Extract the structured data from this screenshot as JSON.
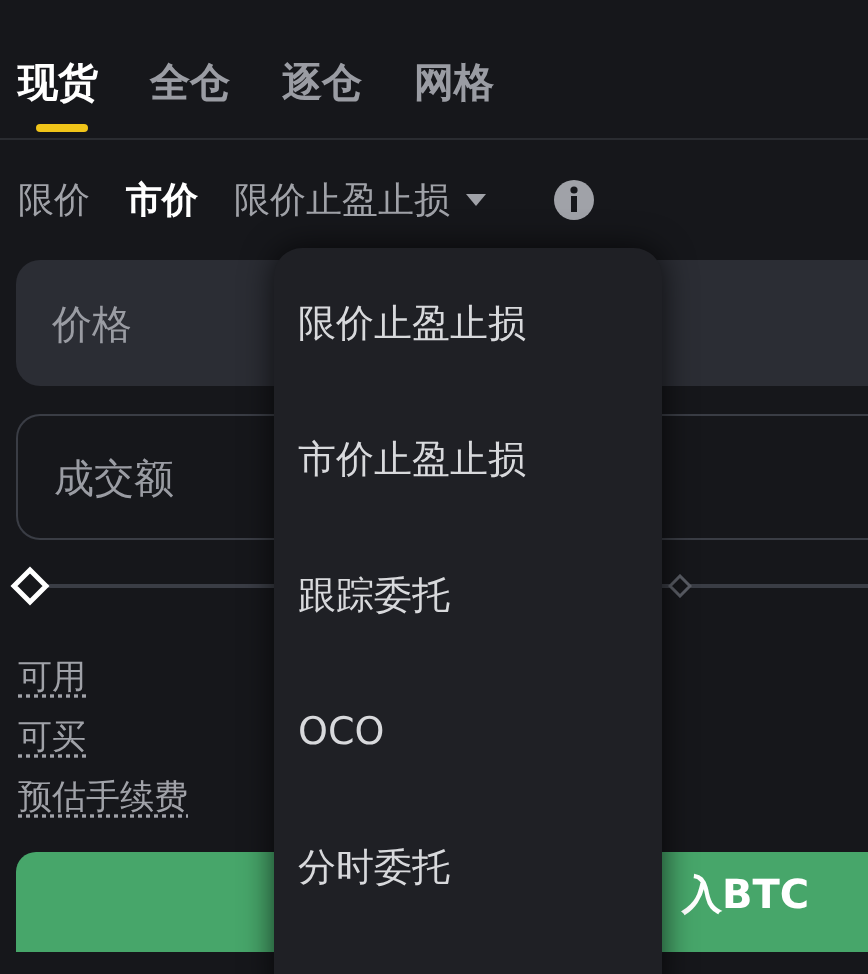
{
  "tabs": [
    {
      "label": "现货",
      "selected": true
    },
    {
      "label": "全仓",
      "selected": false
    },
    {
      "label": "逐仓",
      "selected": false
    },
    {
      "label": "网格",
      "selected": false
    }
  ],
  "order_types": [
    {
      "label": "限价",
      "selected": false
    },
    {
      "label": "市价",
      "selected": true
    },
    {
      "label": "限价止盈止损",
      "selected": false,
      "kind": "dropdown"
    }
  ],
  "price_field": {
    "placeholder": "价格"
  },
  "amount_field": {
    "placeholder": "成交额"
  },
  "slider": {
    "level": 0
  },
  "info": [
    {
      "label": "可用"
    },
    {
      "label": "可买"
    },
    {
      "label": "预估手续费"
    }
  ],
  "buy_button": {
    "label": "入BTC"
  },
  "dropdown_menu": {
    "items": [
      {
        "label": "限价止盈止损"
      },
      {
        "label": "市价止盈止损"
      },
      {
        "label": "跟踪委托"
      },
      {
        "label": "OCO"
      },
      {
        "label": "分时委托"
      }
    ]
  }
}
